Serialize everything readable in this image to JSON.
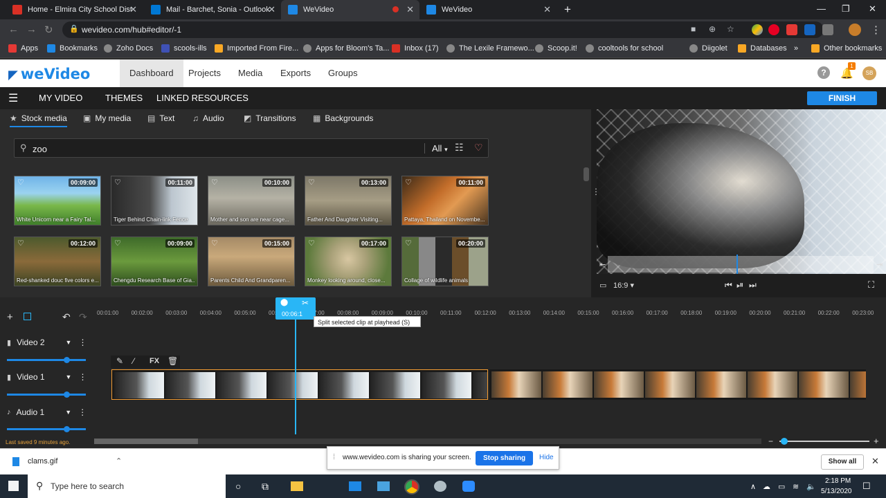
{
  "browser": {
    "tabs": [
      {
        "title": "Home - Elmira City School Distric",
        "color": "#d93025"
      },
      {
        "title": "Mail - Barchet, Sonia - Outlook",
        "color": "#0078d4"
      },
      {
        "title": "WeVideo",
        "color": "#1e88e5"
      },
      {
        "title": "WeVideo",
        "color": "#1e88e5"
      }
    ],
    "url": "wevideo.com/hub#editor/-1",
    "bookmarks": [
      {
        "label": "Apps",
        "color": "#e53935"
      },
      {
        "label": "Bookmarks",
        "color": "#1e88e5"
      },
      {
        "label": "Zoho Docs",
        "color": "#888888"
      },
      {
        "label": "scools-ills",
        "color": "#3f51b5"
      },
      {
        "label": "Imported From Fire...",
        "color": "#f9a825"
      },
      {
        "label": "Apps for Bloom's Ta...",
        "color": "#888888"
      },
      {
        "label": "Inbox (17)",
        "color": "#d93025"
      },
      {
        "label": "The Lexile Framewo...",
        "color": "#888888"
      },
      {
        "label": "Scoop.it!",
        "color": "#888888"
      },
      {
        "label": "cooltools for school",
        "color": "#888888"
      },
      {
        "label": "Diigolet",
        "color": "#888888"
      },
      {
        "label": "Databases",
        "color": "#f9a825"
      },
      {
        "label": "Other bookmarks",
        "color": "#f9a825"
      }
    ],
    "overflow": "»"
  },
  "app": {
    "logo": "weVideo",
    "nav": [
      "Dashboard",
      "Projects",
      "Media",
      "Exports",
      "Groups"
    ],
    "notification_count": "1",
    "avatar_initials": "SB",
    "toolbar": {
      "menu_items": [
        "MY VIDEO",
        "THEMES",
        "LINKED RESOURCES"
      ],
      "finish": "FINISH"
    },
    "media_tabs": [
      "Stock media",
      "My media",
      "Text",
      "Audio",
      "Transitions",
      "Backgrounds"
    ],
    "search": {
      "value": "zoo",
      "filter": "All"
    },
    "thumbnails": [
      {
        "duration": "00:09:00",
        "label": "White Unicorn near a Fairy Tal..."
      },
      {
        "duration": "00:11:00",
        "label": "Tiger Behind Chain-link Fence"
      },
      {
        "duration": "00:10:00",
        "label": "Mother and son are near cage..."
      },
      {
        "duration": "00:13:00",
        "label": "Father And Daughter Visiting..."
      },
      {
        "duration": "00:11:00",
        "label": "Pattaya, Thailand on Novembe..."
      },
      {
        "duration": "00:12:00",
        "label": "Red-shanked douc five colors e..."
      },
      {
        "duration": "00:09:00",
        "label": "Chengdu Research Base of Gia..."
      },
      {
        "duration": "00:15:00",
        "label": "Parents Child And Grandparen..."
      },
      {
        "duration": "00:17:00",
        "label": "Monkey looking around, close..."
      },
      {
        "duration": "00:20:00",
        "label": "Collage of wildlife animals"
      }
    ],
    "preview": {
      "aspect": "16:9"
    },
    "timeline": {
      "ticks": [
        "00:01:00",
        "00:02:00",
        "00:03:00",
        "00:04:00",
        "00:05:00",
        "00:06:00",
        "00:07:00",
        "00:08:00",
        "00:09:00",
        "00:10:00",
        "00:11:00",
        "00:12:00",
        "00:13:00",
        "00:14:00",
        "00:15:00",
        "00:16:00",
        "00:17:00",
        "00:18:00",
        "00:19:00",
        "00:20:00",
        "00:21:00",
        "00:22:00",
        "00:23:00"
      ],
      "playhead_time": "00:06:1",
      "tooltip": "Split selected clip at playhead (S)",
      "tracks": [
        "Video 2",
        "Video 1",
        "Audio 1"
      ],
      "clip_tools": [
        "FX"
      ],
      "last_saved": "Last saved 9 minutes ago."
    }
  },
  "download": {
    "file": "clams.gif",
    "show_all": "Show all"
  },
  "share_banner": {
    "text": "www.wevideo.com is sharing your screen.",
    "stop": "Stop sharing",
    "hide": "Hide"
  },
  "taskbar": {
    "search_placeholder": "Type here to search",
    "time": "2:18 PM",
    "date": "5/13/2020"
  }
}
